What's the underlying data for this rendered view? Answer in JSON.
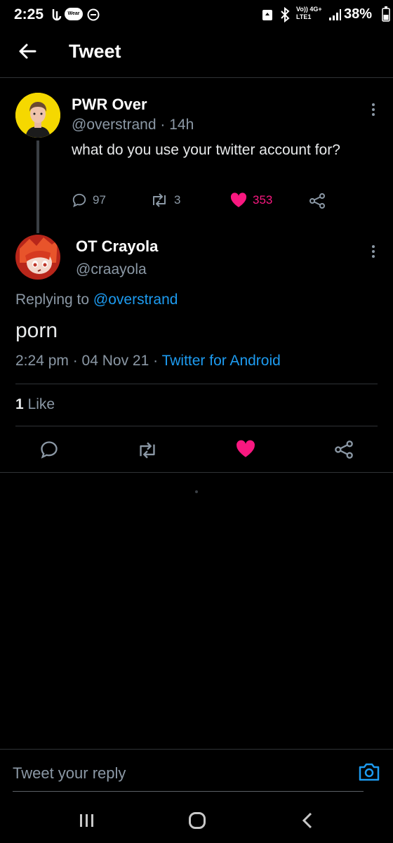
{
  "status_bar": {
    "time": "2:25",
    "wear_badge": "Wear",
    "network": "Vo)) 4G+ LTE1",
    "battery": "38%"
  },
  "header": {
    "title": "Tweet"
  },
  "parent_tweet": {
    "display_name": "PWR Over",
    "handle": "@overstrand",
    "time_ago": "· 14h",
    "text": "what do you use your twitter account for?",
    "replies": "97",
    "retweets": "3",
    "likes": "353"
  },
  "main_tweet": {
    "display_name": "OT Crayola",
    "handle": "@craayola",
    "replying_prefix": "Replying to",
    "replying_to": "@overstrand",
    "text": "porn",
    "timestamp": "2:24 pm · 04 Nov 21 ·",
    "source": "Twitter for Android",
    "like_count": "1",
    "like_label": "Like"
  },
  "reply_bar": {
    "placeholder": "Tweet your reply"
  },
  "colors": {
    "accent": "#1d9bf0",
    "like": "#f91880",
    "muted": "#8b98a5",
    "bg": "#000000"
  },
  "icons": [
    "back-arrow-icon",
    "reply-icon",
    "retweet-icon",
    "heart-icon",
    "share-icon",
    "camera-icon",
    "more-icon"
  ]
}
